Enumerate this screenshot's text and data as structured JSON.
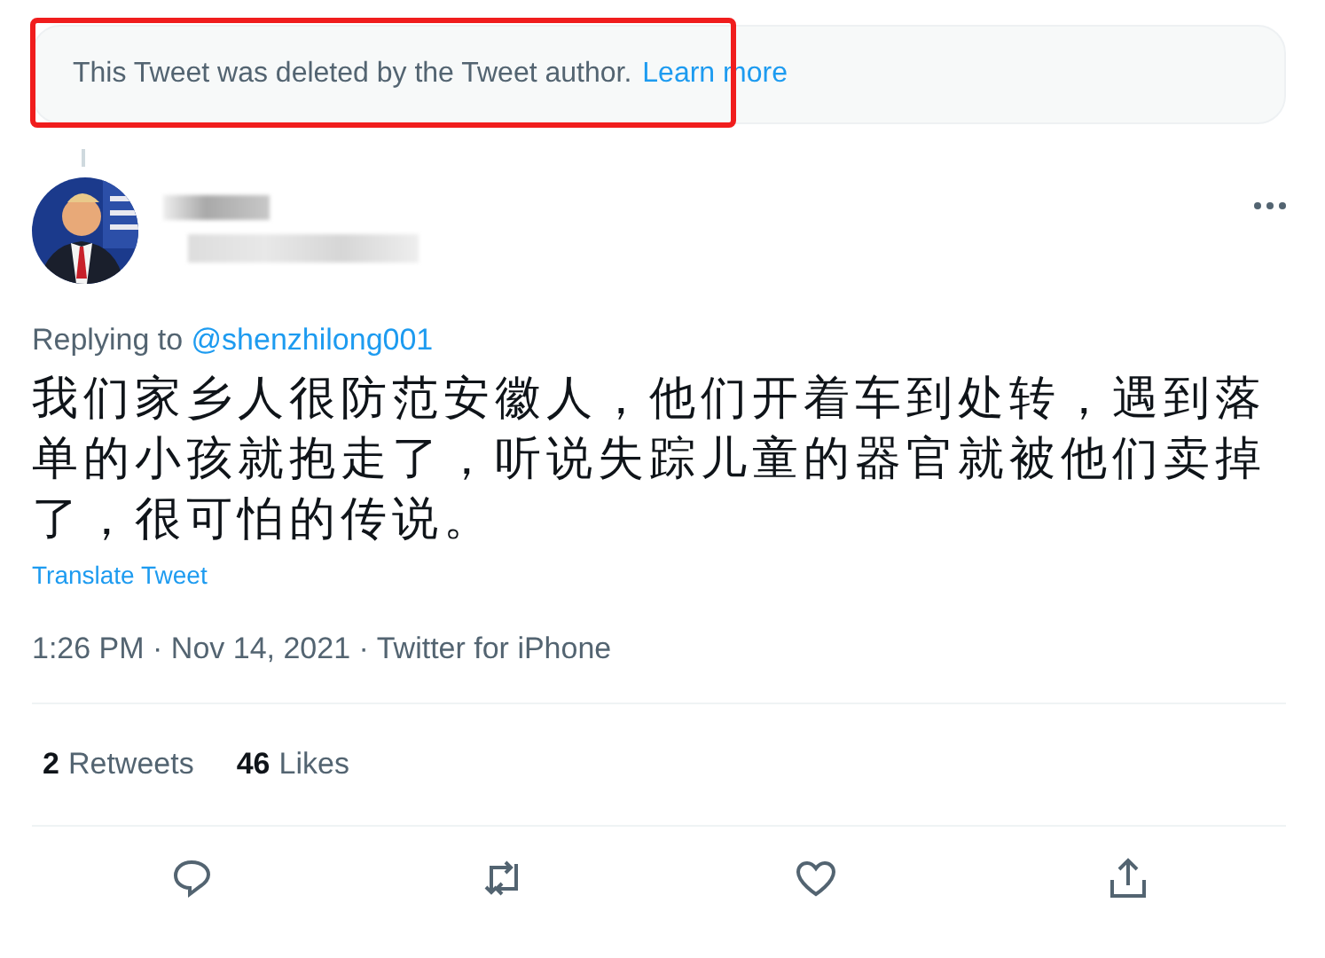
{
  "notice": {
    "text": "This Tweet was deleted by the Tweet author.",
    "link": "Learn more",
    "highlighted": true
  },
  "author": {
    "name_blurred": true
  },
  "replying_to": {
    "label": "Replying to",
    "handle": "@shenzhilong001"
  },
  "tweet_text": "我们家乡人很防范安徽人，他们开着车到处转，遇到落单的小孩就抱走了，听说失踪儿童的器官就被他们卖掉了，很可怕的传说。",
  "translate": "Translate Tweet",
  "meta": "1:26 PM · Nov 14, 2021 · Twitter for iPhone",
  "stats": [
    {
      "count": "2",
      "label": "Retweets"
    },
    {
      "count": "46",
      "label": "Likes"
    }
  ],
  "actions": [
    {
      "kind": "reply"
    },
    {
      "kind": "retweet"
    },
    {
      "kind": "like"
    },
    {
      "kind": "share"
    }
  ]
}
